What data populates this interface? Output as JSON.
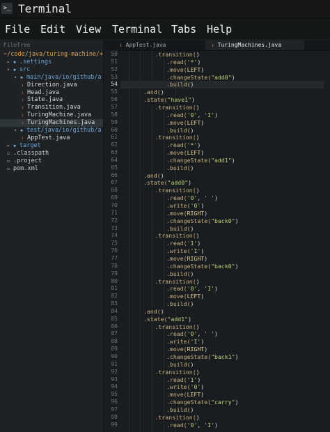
{
  "window": {
    "title": "Terminal",
    "icon": "terminal-icon",
    "icon_text": ">_"
  },
  "menu": [
    "File",
    "Edit",
    "View",
    "Terminal",
    "Tabs",
    "Help"
  ],
  "sidebar": {
    "header": "FileTree",
    "items": [
      {
        "text": "~/code/java/turing-machine/+",
        "kind": "root"
      },
      {
        "text": ".settings",
        "kind": "folder",
        "collapsed": true
      },
      {
        "text": "src",
        "kind": "folder",
        "collapsed": false
      },
      {
        "text": "main/java/io/github/a",
        "kind": "folder",
        "collapsed": false
      },
      {
        "text": "Direction.java",
        "kind": "java"
      },
      {
        "text": "Head.java",
        "kind": "java"
      },
      {
        "text": "State.java",
        "kind": "java"
      },
      {
        "text": "Transition.java",
        "kind": "java"
      },
      {
        "text": "TuringMachine.java",
        "kind": "java"
      },
      {
        "text": "TuringMachines.java",
        "kind": "java",
        "selected": true
      },
      {
        "text": "test/java/io/github/a",
        "kind": "folder",
        "collapsed": false
      },
      {
        "text": "AppTest.java",
        "kind": "java"
      },
      {
        "text": "target",
        "kind": "folder",
        "collapsed": true
      },
      {
        "text": ".classpath",
        "kind": "file"
      },
      {
        "text": ".project",
        "kind": "file"
      },
      {
        "text": "pom.xml",
        "kind": "file"
      }
    ]
  },
  "tabs": [
    {
      "label": "AppTest.java",
      "active": false
    },
    {
      "label": "TuringMachines.java",
      "active": true
    }
  ],
  "editor": {
    "current_line": 54,
    "lines": [
      {
        "n": 50,
        "indent": 3,
        "text": ".transition()"
      },
      {
        "n": 51,
        "indent": 4,
        "text": ".read('*')"
      },
      {
        "n": 52,
        "indent": 4,
        "text": ".move(LEFT)"
      },
      {
        "n": 53,
        "indent": 4,
        "text": ".changeState(\"add0\")"
      },
      {
        "n": 54,
        "indent": 4,
        "text": ".build()"
      },
      {
        "n": 55,
        "indent": 2,
        "text": ".and()"
      },
      {
        "n": 56,
        "indent": 2,
        "text": ".state(\"have1\")"
      },
      {
        "n": 57,
        "indent": 3,
        "text": ".transition()"
      },
      {
        "n": 58,
        "indent": 4,
        "text": ".read('0', 'I')"
      },
      {
        "n": 59,
        "indent": 4,
        "text": ".move(LEFT)"
      },
      {
        "n": 60,
        "indent": 4,
        "text": ".build()"
      },
      {
        "n": 61,
        "indent": 3,
        "text": ".transition()"
      },
      {
        "n": 62,
        "indent": 4,
        "text": ".read('*')"
      },
      {
        "n": 63,
        "indent": 4,
        "text": ".move(LEFT)"
      },
      {
        "n": 64,
        "indent": 4,
        "text": ".changeState(\"add1\")"
      },
      {
        "n": 65,
        "indent": 4,
        "text": ".build()"
      },
      {
        "n": 66,
        "indent": 2,
        "text": ".and()"
      },
      {
        "n": 67,
        "indent": 2,
        "text": ".state(\"add0\")"
      },
      {
        "n": 68,
        "indent": 3,
        "text": ".transition()"
      },
      {
        "n": 69,
        "indent": 4,
        "text": ".read('0', ' ')"
      },
      {
        "n": 70,
        "indent": 4,
        "text": ".write('0')"
      },
      {
        "n": 71,
        "indent": 4,
        "text": ".move(RIGHT)"
      },
      {
        "n": 72,
        "indent": 4,
        "text": ".changeState(\"back0\")"
      },
      {
        "n": 73,
        "indent": 4,
        "text": ".build()"
      },
      {
        "n": 74,
        "indent": 3,
        "text": ".transition()"
      },
      {
        "n": 75,
        "indent": 4,
        "text": ".read('1')"
      },
      {
        "n": 76,
        "indent": 4,
        "text": ".write('I')"
      },
      {
        "n": 77,
        "indent": 4,
        "text": ".move(RIGHT)"
      },
      {
        "n": 78,
        "indent": 4,
        "text": ".changeState(\"back0\")"
      },
      {
        "n": 79,
        "indent": 4,
        "text": ".build()"
      },
      {
        "n": 80,
        "indent": 3,
        "text": ".transition()"
      },
      {
        "n": 81,
        "indent": 4,
        "text": ".read('0', 'I')"
      },
      {
        "n": 82,
        "indent": 4,
        "text": ".move(LEFT)"
      },
      {
        "n": 83,
        "indent": 4,
        "text": ".build()"
      },
      {
        "n": 84,
        "indent": 2,
        "text": ".and()"
      },
      {
        "n": 85,
        "indent": 2,
        "text": ".state(\"add1\")"
      },
      {
        "n": 86,
        "indent": 3,
        "text": ".transition()"
      },
      {
        "n": 87,
        "indent": 4,
        "text": ".read('0', ' ')"
      },
      {
        "n": 88,
        "indent": 4,
        "text": ".write('I')"
      },
      {
        "n": 89,
        "indent": 4,
        "text": ".move(RIGHT)"
      },
      {
        "n": 90,
        "indent": 4,
        "text": ".changeState(\"back1\")"
      },
      {
        "n": 91,
        "indent": 4,
        "text": ".build()"
      },
      {
        "n": 92,
        "indent": 3,
        "text": ".transition()"
      },
      {
        "n": 93,
        "indent": 4,
        "text": ".read('1')"
      },
      {
        "n": 94,
        "indent": 4,
        "text": ".write('0')"
      },
      {
        "n": 95,
        "indent": 4,
        "text": ".move(LEFT)"
      },
      {
        "n": 96,
        "indent": 4,
        "text": ".changeState(\"carry\")"
      },
      {
        "n": 97,
        "indent": 4,
        "text": ".build()"
      },
      {
        "n": 98,
        "indent": 3,
        "text": ".transition()"
      },
      {
        "n": 99,
        "indent": 4,
        "text": ".read('0', 'I')"
      }
    ]
  },
  "colors": {
    "background": "#1a1d1f",
    "folder": "#6fa5d9",
    "java_icon": "#d96f4e",
    "string": "#b9d37a",
    "method": "#c6b07f"
  }
}
